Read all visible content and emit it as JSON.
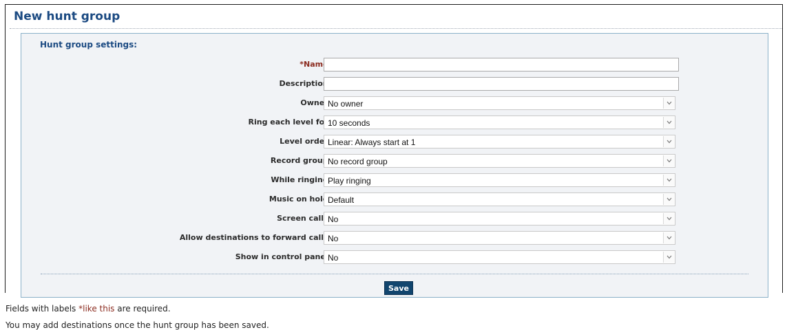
{
  "page": {
    "title": "New hunt group"
  },
  "section": {
    "title": "Hunt group settings:"
  },
  "fields": {
    "name": {
      "label": "*Name:",
      "value": ""
    },
    "description": {
      "label": "Description:",
      "value": ""
    },
    "owner": {
      "label": "Owner:",
      "value": "No owner"
    },
    "ring_each_level": {
      "label": "Ring each level for:",
      "value": "10 seconds"
    },
    "level_order": {
      "label": "Level order:",
      "value": "Linear: Always start at 1"
    },
    "record_group": {
      "label": "Record group:",
      "value": "No record group"
    },
    "while_ringing": {
      "label": "While ringing:",
      "value": "Play ringing"
    },
    "music_on_hold": {
      "label": "Music on hold:",
      "value": "Default"
    },
    "screen_calls": {
      "label": "Screen calls:",
      "value": "No"
    },
    "allow_forward": {
      "label": "Allow destinations to forward calls:",
      "value": "No"
    },
    "show_in_panel": {
      "label": "Show in control panel:",
      "value": "No"
    }
  },
  "actions": {
    "save_label": "Save"
  },
  "notes": {
    "required_prefix": "Fields with labels ",
    "required_example": "*like this",
    "required_suffix": " are required.",
    "destinations": "You may add destinations once the hunt group has been saved."
  },
  "colors": {
    "title": "#1b4a82",
    "required": "#8b2b1f",
    "save_button": "#11456e",
    "panel_background": "#f1f3f6"
  }
}
